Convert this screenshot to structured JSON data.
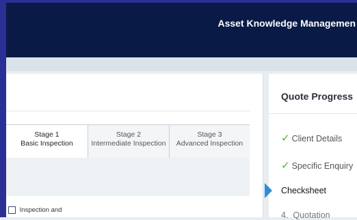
{
  "header": {
    "title": "Asset Knowledge Managemen"
  },
  "stages": [
    {
      "line1": "Stage 1",
      "line2": "Basic Inspection",
      "selected": true
    },
    {
      "line1": "Stage 2",
      "line2": "Intermediate Inspection",
      "selected": false
    },
    {
      "line1": "Stage 3",
      "line2": "Advanced Inspection",
      "selected": false
    }
  ],
  "option": {
    "label": "Inspection and",
    "checked": false
  },
  "progress": {
    "title": "Quote Progress",
    "steps": [
      {
        "label": "Client Details",
        "status": "done",
        "marker": "✓"
      },
      {
        "label": "Specific Enquiry",
        "status": "done",
        "marker": "✓"
      },
      {
        "label": "Checksheet",
        "status": "current",
        "marker": ""
      },
      {
        "label": "Quotation",
        "status": "pending",
        "marker": "4."
      }
    ]
  },
  "colors": {
    "header_bg": "#0a1a47",
    "frame": "#2a2f96",
    "tick": "#4caf32",
    "current_arrow": "#2b8ed6"
  }
}
